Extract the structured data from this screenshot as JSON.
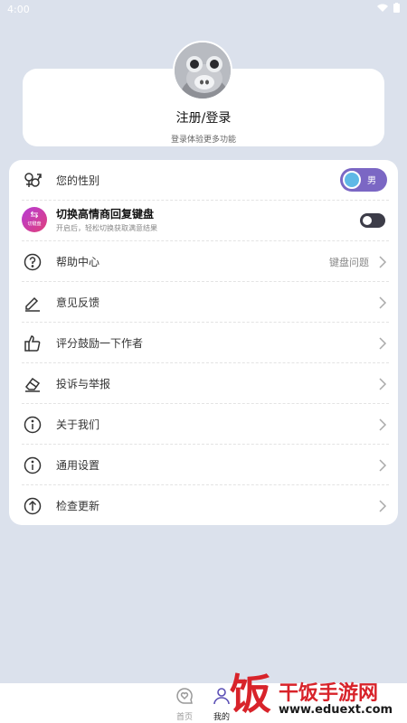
{
  "status_bar": {
    "time": "4:00"
  },
  "profile": {
    "title": "注册/登录",
    "subtitle": "登录体验更多功能"
  },
  "gender": {
    "label": "您的性别",
    "value": "男"
  },
  "keyboard": {
    "logo_text": "⇆",
    "logo_small": "切键盘",
    "title": "切换高情商回复键盘",
    "subtitle": "开启后，轻松切换获取满意结果"
  },
  "menu": {
    "help": {
      "label": "帮助中心",
      "extra": "键盘问题"
    },
    "feedback": {
      "label": "意见反馈"
    },
    "rate": {
      "label": "评分鼓励一下作者"
    },
    "report": {
      "label": "投诉与举报"
    },
    "about": {
      "label": "关于我们"
    },
    "settings": {
      "label": "通用设置"
    },
    "update": {
      "label": "检查更新"
    }
  },
  "tabs": {
    "home": "首页",
    "mine": "我的"
  },
  "watermark": {
    "char": "饭",
    "title": "干饭手游网",
    "url": "www.eduext.com"
  },
  "colors": {
    "background": "#dbe1ec",
    "accent": "#7b67c4",
    "toggle_off": "#3c3c48",
    "watermark_red": "#d8232a"
  }
}
